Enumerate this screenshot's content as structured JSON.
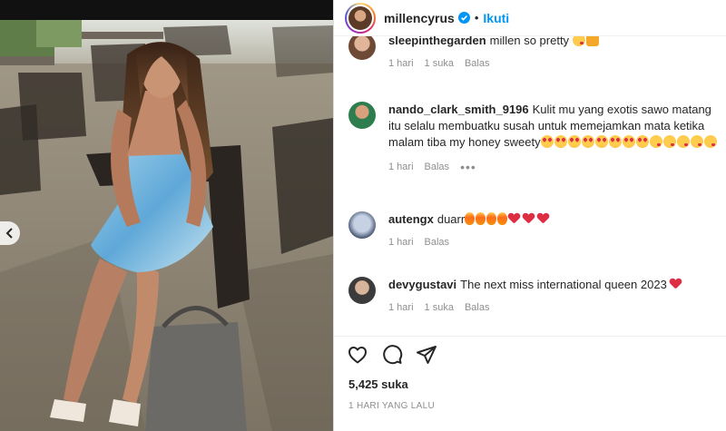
{
  "header": {
    "username": "millencyrus",
    "separator": "•",
    "follow_label": "Ikuti"
  },
  "comments": [
    {
      "username": "sleepinthegarden",
      "text": "millen so pretty",
      "emojis": [
        "grin",
        "raised-hands"
      ],
      "time": "1 hari",
      "likes": "1 suka",
      "reply": "Balas"
    },
    {
      "username": "nando_clark_smith_9196",
      "text": "Kulit mu yang exotis sawo matang itu selalu membuatku susah untuk memejamkan mata ketika malam tiba my honey sweety",
      "emojis": [
        "heart-eyes",
        "heart-eyes",
        "heart-eyes",
        "heart-eyes",
        "heart-eyes",
        "heart-eyes",
        "heart-eyes",
        "heart-eyes",
        "kiss",
        "kiss",
        "kiss",
        "kiss",
        "kiss"
      ],
      "time": "1 hari",
      "reply": "Balas",
      "more": "•••"
    },
    {
      "username": "autengx",
      "text": "duarr",
      "emojis": [
        "fire",
        "fire",
        "fire",
        "fire",
        "heart",
        "heart",
        "heart"
      ],
      "time": "1 hari",
      "reply": "Balas"
    },
    {
      "username": "devygustavi",
      "text": "The next miss international queen 2023",
      "emojis": [
        "heart"
      ],
      "time": "1 hari",
      "likes": "1 suka",
      "reply": "Balas"
    }
  ],
  "actions": {
    "like_icon": "heart-outline-icon",
    "comment_icon": "comment-bubble-icon",
    "share_icon": "paper-plane-icon"
  },
  "likes_total": "5,425 suka",
  "posted": "1 HARI YANG LALU",
  "colors": {
    "accent": "#0095f6",
    "text": "#262626",
    "muted": "#8e8e8e",
    "border": "#dbdbdb"
  }
}
